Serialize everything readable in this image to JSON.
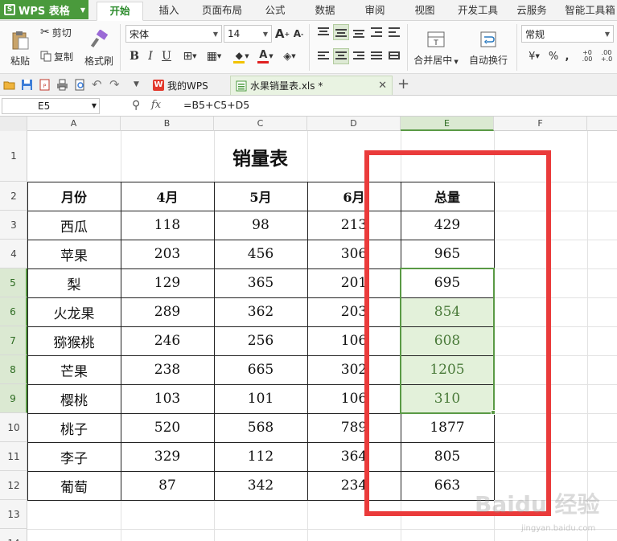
{
  "app": {
    "name": "WPS 表格"
  },
  "menu": {
    "tabs": [
      "开始",
      "插入",
      "页面布局",
      "公式",
      "数据",
      "审阅",
      "视图",
      "开发工具",
      "云服务",
      "智能工具箱"
    ],
    "active": "开始"
  },
  "ribbon": {
    "paste": "粘贴",
    "cut": "剪切",
    "copy": "复制",
    "format_painter": "格式刷",
    "font_name": "宋体",
    "font_size": "14",
    "merge_center": "合并居中",
    "wrap_text": "自动换行",
    "number_format": "常规"
  },
  "doc_tabs": {
    "home": "我的WPS",
    "active": "水果销量表.xls *"
  },
  "formula_bar": {
    "name_box": "E5",
    "fx": "fx",
    "formula": "=B5+C5+D5"
  },
  "grid": {
    "columns": [
      "A",
      "B",
      "C",
      "D",
      "E",
      "F"
    ],
    "rows": [
      "1",
      "2",
      "3",
      "4",
      "5",
      "6",
      "7",
      "8",
      "9",
      "10",
      "11",
      "12",
      "13",
      "14"
    ],
    "title": "销量表",
    "headers": [
      "月份",
      "4月",
      "5月",
      "6月",
      "总量"
    ],
    "data": [
      [
        "西瓜",
        "118",
        "98",
        "213",
        "429"
      ],
      [
        "苹果",
        "203",
        "456",
        "306",
        "965"
      ],
      [
        "梨",
        "129",
        "365",
        "201",
        "695"
      ],
      [
        "火龙果",
        "289",
        "362",
        "203",
        "854"
      ],
      [
        "猕猴桃",
        "246",
        "256",
        "106",
        "608"
      ],
      [
        "芒果",
        "238",
        "665",
        "302",
        "1205"
      ],
      [
        "樱桃",
        "103",
        "101",
        "106",
        "310"
      ],
      [
        "桃子",
        "520",
        "568",
        "789",
        "1877"
      ],
      [
        "李子",
        "329",
        "112",
        "364",
        "805"
      ],
      [
        "葡萄",
        "87",
        "342",
        "234",
        "663"
      ]
    ]
  },
  "watermark": {
    "brand": "Baidu 经验",
    "url": "jingyan.baidu.com"
  },
  "colors": {
    "accent": "#4a9a3c",
    "selection": "#5a9a45",
    "highlight_box": "#ea3b3b"
  }
}
